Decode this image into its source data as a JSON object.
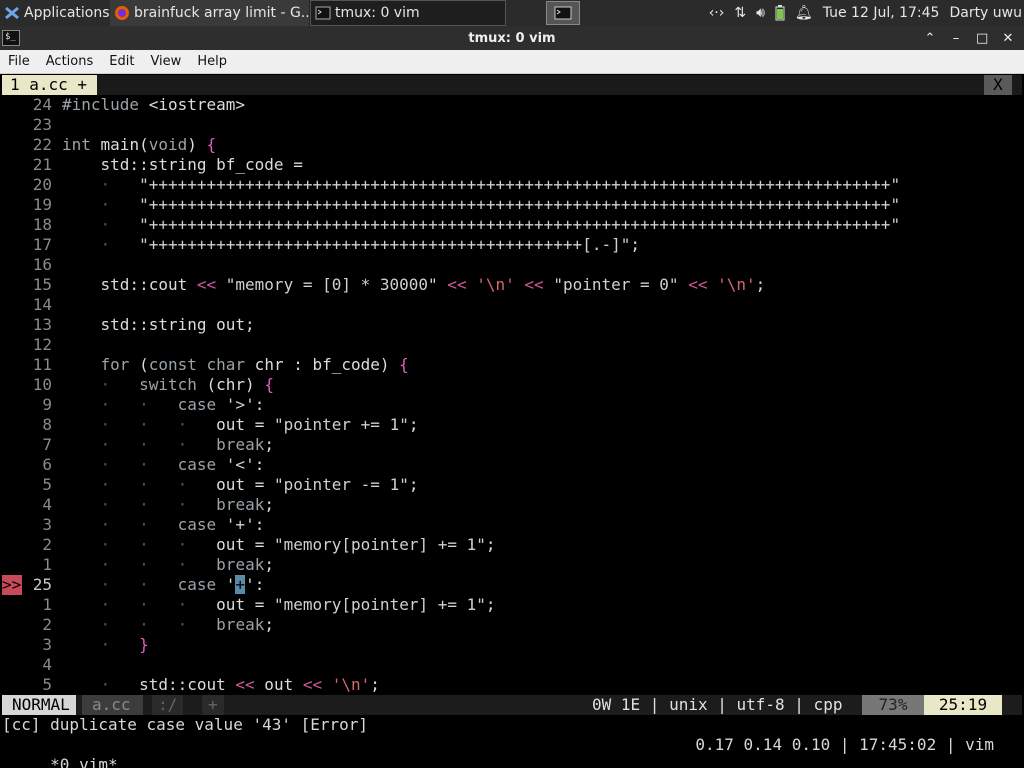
{
  "panel": {
    "apps_label": "Applications ☰",
    "tasks": [
      {
        "label": "brainfuck array limit - G..."
      },
      {
        "label": "tmux: 0 vim"
      }
    ],
    "clock": "Tue 12 Jul, 17:45",
    "user": "Darty uwu"
  },
  "window": {
    "title": "tmux: 0 vim",
    "controls": {
      "minimize": "⌃",
      "restore": "–",
      "maximize": "□",
      "close": "✕"
    }
  },
  "menu": [
    "File",
    "Actions",
    "Edit",
    "View",
    "Help"
  ],
  "vim": {
    "tab": {
      "label": "1 a.cc +",
      "close": "X"
    },
    "lines": [
      {
        "n": "24",
        "text": "#include <iostream>"
      },
      {
        "n": "23",
        "text": ""
      },
      {
        "n": "22",
        "text": "int main(void) {"
      },
      {
        "n": "21",
        "text": "    std::string bf_code ="
      },
      {
        "n": "20",
        "text": "    ·   \"+++++++++++++++++++++++++++++++++++++++++++++++++++++++++++++++++++++++++++++\""
      },
      {
        "n": "19",
        "text": "    ·   \"+++++++++++++++++++++++++++++++++++++++++++++++++++++++++++++++++++++++++++++\""
      },
      {
        "n": "18",
        "text": "    ·   \"+++++++++++++++++++++++++++++++++++++++++++++++++++++++++++++++++++++++++++++\""
      },
      {
        "n": "17",
        "text": "    ·   \"+++++++++++++++++++++++++++++++++++++++++++++[.-]\";"
      },
      {
        "n": "16",
        "text": ""
      },
      {
        "n": "15",
        "text": "    std::cout << \"memory = [0] * 30000\" << '\\n' << \"pointer = 0\" << '\\n';"
      },
      {
        "n": "14",
        "text": ""
      },
      {
        "n": "13",
        "text": "    std::string out;"
      },
      {
        "n": "12",
        "text": ""
      },
      {
        "n": "11",
        "text": "    for (const char chr : bf_code) {"
      },
      {
        "n": "10",
        "text": "    ·   switch (chr) {"
      },
      {
        "n": "9",
        "text": "    ·   ·   case '>':"
      },
      {
        "n": "8",
        "text": "    ·   ·   ·   out = \"pointer += 1\";"
      },
      {
        "n": "7",
        "text": "    ·   ·   ·   break;"
      },
      {
        "n": "6",
        "text": "    ·   ·   case '<':"
      },
      {
        "n": "5",
        "text": "    ·   ·   ·   out = \"pointer -= 1\";"
      },
      {
        "n": "4",
        "text": "    ·   ·   ·   break;"
      },
      {
        "n": "3",
        "text": "    ·   ·   case '+':"
      },
      {
        "n": "2",
        "text": "    ·   ·   ·   out = \"memory[pointer] += 1\";"
      },
      {
        "n": "1",
        "text": "    ·   ·   ·   break;"
      },
      {
        "n": "25",
        "sign": ">>",
        "current": true,
        "pre": "    ·   ·   case '",
        "cursor": "+",
        "post": "':"
      },
      {
        "n": "1",
        "text": "    ·   ·   ·   out = \"memory[pointer] += 1\";"
      },
      {
        "n": "2",
        "text": "    ·   ·   ·   break;"
      },
      {
        "n": "3",
        "text": "    ·   }"
      },
      {
        "n": "4",
        "text": ""
      },
      {
        "n": "5",
        "text": "    ·   std::cout << out << '\\n';"
      }
    ],
    "status": {
      "mode": "NORMAL",
      "file": "a.cc",
      "seg1": ":/",
      "seg2": "+",
      "info": "0W 1E | unix | utf-8 | cpp",
      "percent": "73%",
      "position": "25:19"
    },
    "message": "[cc] duplicate case value '43' [Error]"
  },
  "tmux": {
    "left": " *0 vim*",
    "right": "0.17 0.14 0.10 | 17:45:02 | vim"
  }
}
